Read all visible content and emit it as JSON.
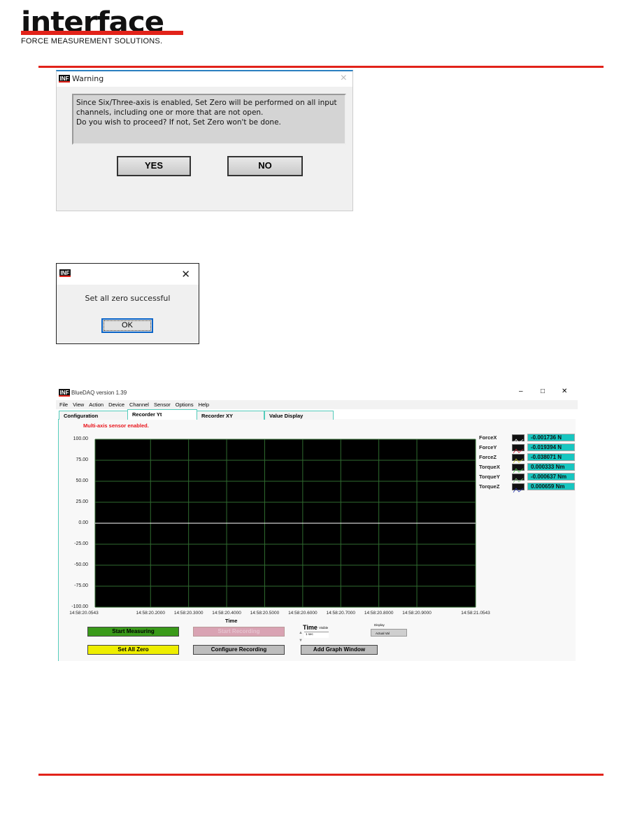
{
  "header": {
    "logo_word": "interface",
    "logo_tagline": "FORCE MEASUREMENT SOLUTIONS."
  },
  "warning_dialog": {
    "title": "Warning",
    "message_lines": [
      "Since Six/Three-axis is enabled, Set Zero will be performed on all input",
      "channels, including one or more that are not open.",
      "Do you wish to proceed? If not, Set Zero won't be done."
    ],
    "yes_label": "YES",
    "no_label": "NO",
    "close_glyph": "×",
    "app_icon": "INF"
  },
  "success_dialog": {
    "message": "Set all zero successful",
    "ok_label": "OK",
    "close_glyph": "✕",
    "app_icon": "INF"
  },
  "app": {
    "title": "BlueDAQ version 1.39",
    "app_icon": "INF",
    "window_controls": [
      "–",
      "□",
      "✕"
    ],
    "menu": [
      "File",
      "View",
      "Action",
      "Device",
      "Channel",
      "Sensor",
      "Options",
      "Help"
    ],
    "tabs": [
      "Configuration",
      "Recorder Yt",
      "Recorder XY",
      "Value Display"
    ],
    "active_tab": "Recorder Yt",
    "status": "Multi-axis sensor enabled.",
    "channels": [
      {
        "name": "ForceX",
        "value": "-0.001736 N",
        "color": "#ffffff"
      },
      {
        "name": "ForceY",
        "value": "-0.019394 N",
        "color": "#cc2233"
      },
      {
        "name": "ForceZ",
        "value": "-0.038071 N",
        "color": "#cccc33"
      },
      {
        "name": "TorqueX",
        "value": "0.000333 Nm",
        "color": "#55cc55"
      },
      {
        "name": "TorqueY",
        "value": "-0.000637 Nm",
        "color": "#88cc88"
      },
      {
        "name": "TorqueZ",
        "value": "0.000659 Nm",
        "color": "#2233aa"
      }
    ],
    "buttons": {
      "start_measuring": "Start Measuring",
      "start_recording": "Start Recording",
      "set_all_zero": "Set All Zero",
      "configure_recording": "Configure Recording",
      "add_graph_window": "Add Graph Window"
    },
    "time_control": {
      "label": "Time",
      "sublabel": "Visible",
      "value": "1 sec"
    },
    "display_control": {
      "label": "Display",
      "value": "Actual Val"
    },
    "colors": {
      "start_measuring": "#3a9a1a",
      "set_all_zero": "#eeee00",
      "start_recording_disabled": "#d9a3b3",
      "value_bg": "#17c6c0",
      "status": "#e8141b"
    }
  },
  "chart_data": {
    "type": "line",
    "title": "",
    "xlabel": "Time",
    "ylabel": "",
    "ylim": [
      -100,
      100
    ],
    "yticks": [
      "100.00",
      "75.00",
      "50.00",
      "25.00",
      "0.00",
      "-25.00",
      "-50.00",
      "-75.00",
      "-100.00"
    ],
    "xlim_seconds": [
      20.0543,
      21.0543
    ],
    "xticks": [
      {
        "label": "14:58:20.0543",
        "t": 20.0543
      },
      {
        "label": "14:58:20.2000",
        "t": 20.2
      },
      {
        "label": "14:58:20.3000",
        "t": 20.3
      },
      {
        "label": "14:58:20.4000",
        "t": 20.4
      },
      {
        "label": "14:58:20.5000",
        "t": 20.5
      },
      {
        "label": "14:58:20.6000",
        "t": 20.6
      },
      {
        "label": "14:58:20.7000",
        "t": 20.7
      },
      {
        "label": "14:58:20.8000",
        "t": 20.8
      },
      {
        "label": "14:58:20.9000",
        "t": 20.9
      },
      {
        "label": "14:58:21.0543",
        "t": 21.0543
      }
    ],
    "series": [
      {
        "x": [
          20.0543,
          21.0543
        ],
        "y": [
          0,
          0
        ]
      }
    ],
    "grid": true,
    "background": "#000000",
    "grid_color": "#2f6b2f"
  }
}
